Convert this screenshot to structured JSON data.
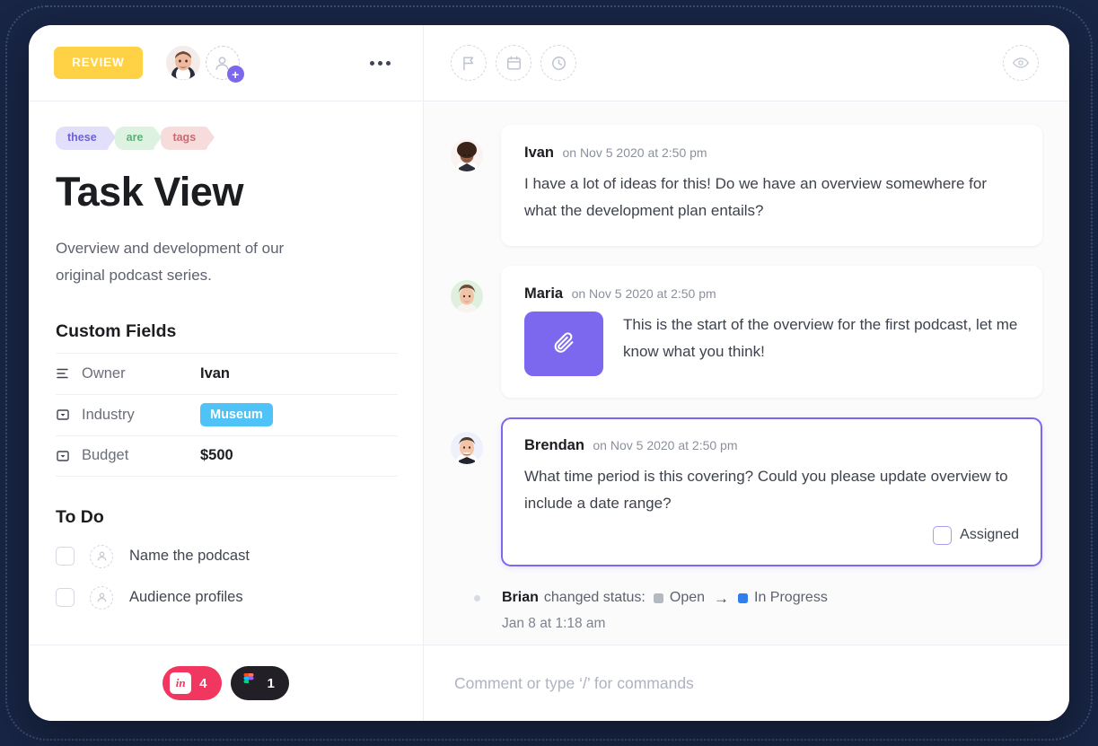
{
  "header": {
    "status_label": "REVIEW",
    "add_assignee_icon": "add-user-icon",
    "more_icon": "ellipsis-icon"
  },
  "toolbar": {
    "flag_icon": "flag-icon",
    "calendar_icon": "calendar-icon",
    "clock_icon": "clock-icon",
    "watch_icon": "eye-icon"
  },
  "task": {
    "tags": [
      {
        "label": "these",
        "bg": "#e1dff9",
        "color": "#6d61d8"
      },
      {
        "label": "are",
        "bg": "#ddf2e1",
        "color": "#57b374"
      },
      {
        "label": "tags",
        "bg": "#f6dddc",
        "color": "#c96a72"
      }
    ],
    "title": "Task View",
    "description": "Overview and development of our original podcast series."
  },
  "custom_fields": {
    "heading": "Custom Fields",
    "rows": [
      {
        "icon": "text-lines-icon",
        "label": "Owner",
        "value": "Ivan",
        "type": "text"
      },
      {
        "icon": "dropdown-icon",
        "label": "Industry",
        "value": "Museum",
        "type": "pill",
        "pill_color": "#4fc3f7"
      },
      {
        "icon": "dropdown-icon",
        "label": "Budget",
        "value": "$500",
        "type": "text"
      }
    ]
  },
  "todo": {
    "heading": "To Do",
    "items": [
      {
        "label": "Name the podcast",
        "checked": false
      },
      {
        "label": "Audience profiles",
        "checked": false
      }
    ]
  },
  "integrations": [
    {
      "name": "invision",
      "logo_text": "in",
      "count": "4",
      "bg": "#f1375f"
    },
    {
      "name": "figma",
      "logo_text": "",
      "count": "1",
      "bg": "#221f26"
    }
  ],
  "comments": [
    {
      "author": "Ivan",
      "timestamp": "on Nov 5 2020 at 2:50 pm",
      "text": "I have a lot of ideas for this! Do we have an overview somewhere for what the development plan entails?",
      "has_attachment": false,
      "highlighted": false
    },
    {
      "author": "Maria",
      "timestamp": "on Nov 5 2020 at 2:50 pm",
      "text": "This is the start of the overview for the first podcast, let me know what you think!",
      "has_attachment": true,
      "attachment_icon": "paperclip-icon",
      "highlighted": false
    },
    {
      "author": "Brendan",
      "timestamp": "on Nov 5 2020 at 2:50 pm",
      "text": "What time period is this covering? Could you please update overview to include a date range?",
      "has_attachment": false,
      "highlighted": true,
      "assigned_label": "Assigned",
      "assigned_checked": false
    }
  ],
  "status_change": {
    "actor": "Brian",
    "action": "changed status:",
    "from_status": "Open",
    "from_color": "#b4b8c0",
    "to_status": "In Progress",
    "to_color": "#2f80ed",
    "arrow": "→",
    "date": "Jan 8 at 1:18 am"
  },
  "comment_box": {
    "placeholder": "Comment or type ‘/’ for commands",
    "value": ""
  }
}
